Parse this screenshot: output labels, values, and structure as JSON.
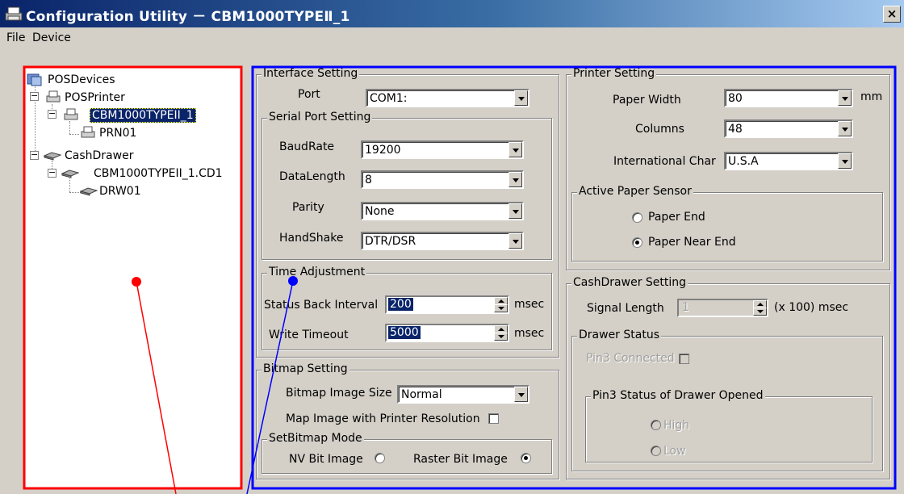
{
  "window": {
    "title": "Configuration Utility －  CBM1000TYPEⅡ_1",
    "close_glyph": "×"
  },
  "menu": [
    "File",
    "Device"
  ],
  "tree": {
    "root": "POSDevices",
    "printer_group": "POSPrinter",
    "printer_device": "CBM1000TYPEII_1",
    "printer_logical": "PRN01",
    "drawer_group": "CashDrawer",
    "drawer_device": "CBM1000TYPEII_1.CD1",
    "drawer_logical": "DRW01"
  },
  "interface": {
    "title": "Interface Setting",
    "port_label": "Port",
    "port_value": "COM1:",
    "serial": {
      "title": "Serial Port Setting",
      "baud_label": "BaudRate",
      "baud_value": "19200",
      "datalength_label": "DataLength",
      "datalength_value": "8",
      "parity_label": "Parity",
      "parity_value": "None",
      "handshake_label": "HandShake",
      "handshake_value": "DTR/DSR"
    },
    "time": {
      "title": "Time Adjustment",
      "status_label": "Status Back Interval",
      "status_value": "200",
      "status_unit": "msec",
      "write_label": "Write Timeout",
      "write_value": "5000",
      "write_unit": "msec"
    }
  },
  "bitmap": {
    "title": "Bitmap Setting",
    "size_label": "Bitmap Image  Size",
    "size_value": "Normal",
    "map_label": "Map Image with Printer Resolution",
    "mode_title": "SetBitmap Mode",
    "nv_label": "NV Bit Image",
    "raster_label": "Raster Bit Image",
    "selected_mode": "Raster Bit Image"
  },
  "printer": {
    "title": "Printer Setting",
    "width_label": "Paper Width",
    "width_value": "80",
    "width_unit": "mm",
    "columns_label": "Columns",
    "columns_value": "48",
    "intl_label": "International Char",
    "intl_value": "U.S.A",
    "sensor_title": "Active Paper Sensor",
    "paper_end": "Paper End",
    "paper_near_end": "Paper Near End",
    "selected_sensor": "Paper Near End"
  },
  "cashdrawer": {
    "title": "CashDrawer Setting",
    "signal_label": "Signal Length",
    "signal_value": "1",
    "signal_unit": "(x 100) msec",
    "status_title": "Drawer Status",
    "pin3_connected": "Pin3 Connected",
    "pin3_status_title": "Pin3 Status of Drawer Opened",
    "high": "High",
    "low": "Low"
  },
  "colors": {
    "red_annotation": "#ff0000",
    "blue_annotation": "#0000ff",
    "selection": "#0a246a",
    "face": "#d4d0c8"
  }
}
